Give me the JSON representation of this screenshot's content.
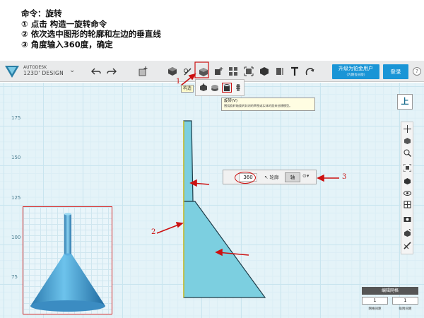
{
  "instructions": {
    "title": "命令：旋转",
    "step1": "① 点击 构造一旋转命令",
    "step2": "② 依次选中图形的轮廓和左边的垂直线",
    "step3": "③ 角度输入360度，确定"
  },
  "app": {
    "brand_line1": "AUTODESK",
    "brand_line2": "123D' DESIGN"
  },
  "toolbar": {
    "upgrade_label": "升级为铂金用户",
    "upgrade_sublabel": "(为期会员版)",
    "login_label": "登录",
    "help_label": "?"
  },
  "construct_tag": "构造",
  "tooltip": {
    "title": "旋转(V)",
    "desc": "围绕旋转轴旋转封闭的草图或实体的面来创建模型。"
  },
  "axis_ticks": [
    "175",
    "150",
    "125",
    "100",
    "75"
  ],
  "revolve_bar": {
    "angle_value": "360",
    "profile_label": "轮廓",
    "axis_label": "轴",
    "more_label": "⊙▾"
  },
  "view_cube_label": "上",
  "edit_grid": {
    "title": "编辑网格",
    "field1_value": "1",
    "field2_value": "1",
    "field1_caption": "网格间距",
    "field2_caption": "吸附间距"
  },
  "annotations": {
    "n1": "1",
    "n2": "2",
    "n3": "3"
  },
  "colors": {
    "accent": "#1a95d6",
    "annotation_red": "#cc1111",
    "profile_fill": "#7ccfe0",
    "preview_fill": "#4aa3d6"
  }
}
